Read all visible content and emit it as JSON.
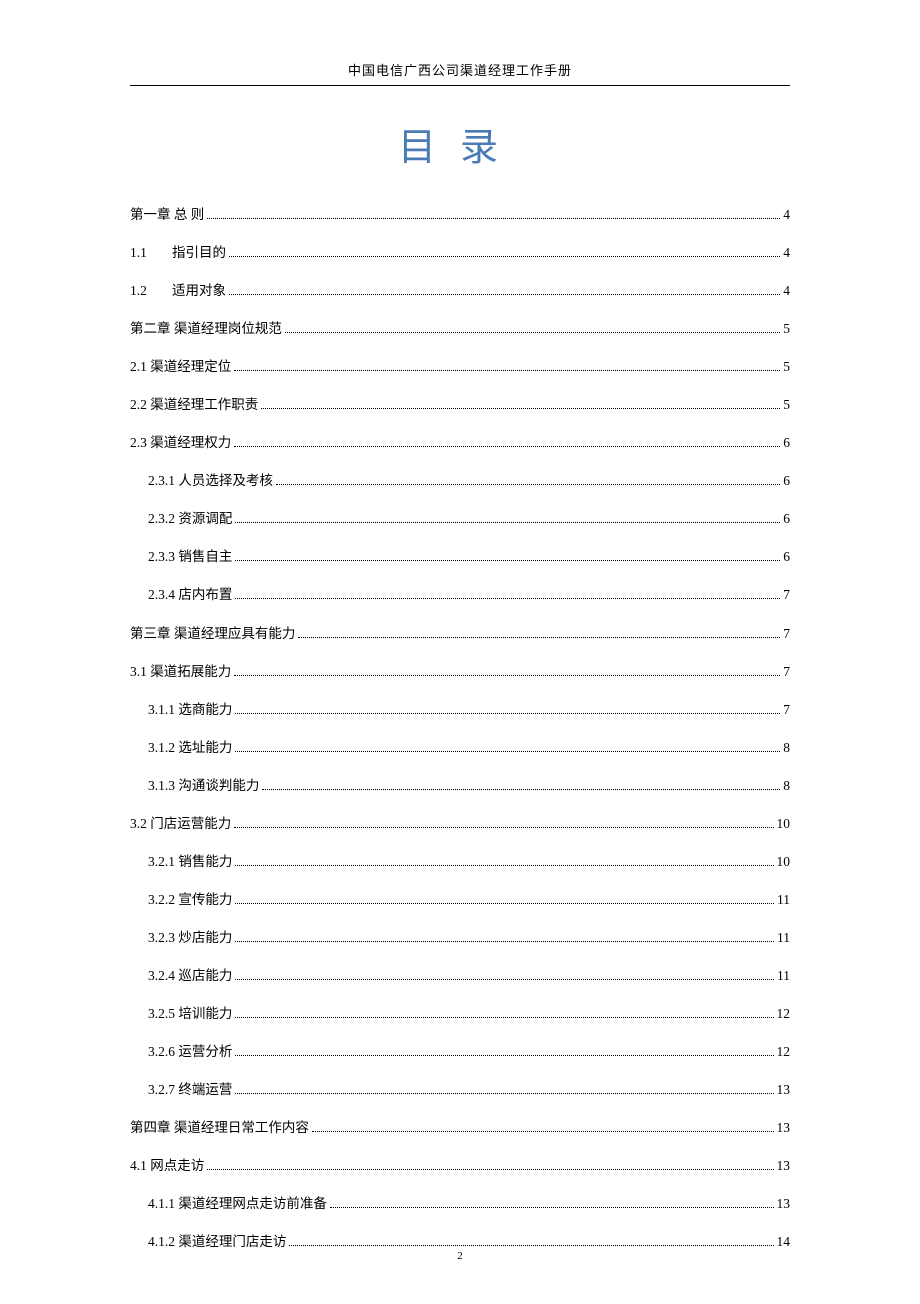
{
  "header": "中国电信广西公司渠道经理工作手册",
  "title": "目录",
  "page_number": "2",
  "toc": [
    {
      "label": "第一章  总  则",
      "page": "4",
      "level": 0,
      "wide": false
    },
    {
      "label_num": "1.1",
      "label_text": "指引目的",
      "page": "4",
      "level": 1,
      "wide": true
    },
    {
      "label_num": "1.2",
      "label_text": "适用对象",
      "page": "4",
      "level": 1,
      "wide": true
    },
    {
      "label": "第二章  渠道经理岗位规范",
      "page": "5",
      "level": 0,
      "wide": false
    },
    {
      "label": "2.1  渠道经理定位",
      "page": "5",
      "level": 0,
      "wide": false
    },
    {
      "label": "2.2  渠道经理工作职责",
      "page": "5",
      "level": 0,
      "wide": false
    },
    {
      "label": "2.3  渠道经理权力",
      "page": "6",
      "level": 0,
      "wide": false
    },
    {
      "label": "2.3.1 人员选择及考核",
      "page": "6",
      "level": 2,
      "wide": false
    },
    {
      "label": "2.3.2 资源调配",
      "page": "6",
      "level": 2,
      "wide": false
    },
    {
      "label": "2.3.3 销售自主",
      "page": "6",
      "level": 2,
      "wide": false
    },
    {
      "label": "2.3.4 店内布置",
      "page": "7",
      "level": 2,
      "wide": false
    },
    {
      "label": "第三章  渠道经理应具有能力",
      "page": "7",
      "level": 0,
      "wide": false
    },
    {
      "label": "3.1  渠道拓展能力",
      "page": "7",
      "level": 0,
      "wide": false
    },
    {
      "label": "3.1.1 选商能力",
      "page": "7",
      "level": 2,
      "wide": false
    },
    {
      "label": "3.1.2  选址能力",
      "page": "8",
      "level": 2,
      "wide": false
    },
    {
      "label": "3.1.3  沟通谈判能力",
      "page": "8",
      "level": 2,
      "wide": false
    },
    {
      "label": "3.2  门店运营能力",
      "page": "10",
      "level": 0,
      "wide": false
    },
    {
      "label": "3.2.1 销售能力",
      "page": "10",
      "level": 2,
      "wide": false
    },
    {
      "label": "3.2.2  宣传能力",
      "page": "11",
      "level": 2,
      "wide": false
    },
    {
      "label": "3.2.3 炒店能力",
      "page": "11",
      "level": 2,
      "wide": false
    },
    {
      "label": "3.2.4  巡店能力",
      "page": "11",
      "level": 2,
      "wide": false
    },
    {
      "label": "3.2.5 培训能力",
      "page": "12",
      "level": 2,
      "wide": false
    },
    {
      "label": "3.2.6  运营分析",
      "page": "12",
      "level": 2,
      "wide": false
    },
    {
      "label": "3.2.7 终端运营",
      "page": "13",
      "level": 2,
      "wide": false
    },
    {
      "label": "第四章  渠道经理日常工作内容",
      "page": "13",
      "level": 0,
      "wide": false
    },
    {
      "label": "4.1 网点走访",
      "page": "13",
      "level": 0,
      "wide": false
    },
    {
      "label": "4.1.1  渠道经理网点走访前准备",
      "page": "13",
      "level": 2,
      "wide": false
    },
    {
      "label": "4.1.2  渠道经理门店走访",
      "page": "14",
      "level": 2,
      "wide": false
    }
  ]
}
